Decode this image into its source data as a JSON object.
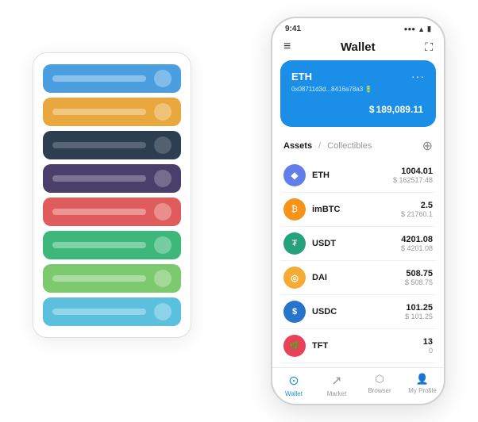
{
  "scene": {
    "card_stack": {
      "cards": [
        {
          "id": "blue",
          "color": "#4B9FE1",
          "dot_color": "#2a7abf"
        },
        {
          "id": "orange",
          "color": "#E8A83E",
          "dot_color": "#c4821a"
        },
        {
          "id": "dark",
          "color": "#2C3E50",
          "dot_color": "#1a2530"
        },
        {
          "id": "purple",
          "color": "#4A3F6B",
          "dot_color": "#2e2645"
        },
        {
          "id": "red",
          "color": "#E05C5C",
          "dot_color": "#b83333"
        },
        {
          "id": "green",
          "color": "#3DB87A",
          "dot_color": "#1e8f55"
        },
        {
          "id": "lightgreen",
          "color": "#7DC96E",
          "dot_color": "#4ea53e"
        },
        {
          "id": "sky",
          "color": "#5BBFDE",
          "dot_color": "#2a9ab8"
        }
      ]
    },
    "phone": {
      "status_bar": {
        "time": "9:41",
        "signal": "●●●",
        "wifi": "▲",
        "battery": "▮"
      },
      "header": {
        "menu_icon": "≡",
        "title": "Wallet",
        "expand_icon": "⛶"
      },
      "eth_card": {
        "symbol": "ETH",
        "address": "0x08711d3d...8416a78a3 🔋",
        "balance_prefix": "$",
        "balance": "189,089.11",
        "more_icon": "···"
      },
      "assets_section": {
        "tab_active": "Assets",
        "tab_divider": "/",
        "tab_inactive": "Collectibles",
        "add_icon": "⊕"
      },
      "assets": [
        {
          "symbol": "ETH",
          "icon": "◆",
          "icon_bg": "#627eea",
          "amount": "1004.01",
          "value": "$ 162517.48"
        },
        {
          "symbol": "imBTC",
          "icon": "₿",
          "icon_bg": "#f7931a",
          "amount": "2.5",
          "value": "$ 21760.1"
        },
        {
          "symbol": "USDT",
          "icon": "₮",
          "icon_bg": "#26a17b",
          "amount": "4201.08",
          "value": "$ 4201.08"
        },
        {
          "symbol": "DAI",
          "icon": "◎",
          "icon_bg": "#f5ac37",
          "amount": "508.75",
          "value": "$ 508.75"
        },
        {
          "symbol": "USDC",
          "icon": "$",
          "icon_bg": "#2775ca",
          "amount": "101.25",
          "value": "$ 101.25"
        },
        {
          "symbol": "TFT",
          "icon": "🌿",
          "icon_bg": "#e8415a",
          "amount": "13",
          "value": "0"
        }
      ],
      "bottom_nav": [
        {
          "id": "wallet",
          "label": "Wallet",
          "icon": "⊙",
          "active": true
        },
        {
          "id": "market",
          "label": "Market",
          "icon": "↗",
          "active": false
        },
        {
          "id": "browser",
          "label": "Browser",
          "icon": "👤",
          "active": false
        },
        {
          "id": "profile",
          "label": "My Profile",
          "icon": "👤",
          "active": false
        }
      ]
    }
  }
}
